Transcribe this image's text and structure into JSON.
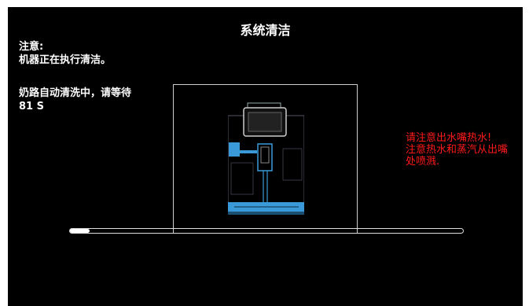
{
  "screen": {
    "title": "系统清洁",
    "note_heading": "注意:",
    "note_body": "机器正在执行清洁。",
    "wait_message": "奶路自动清洗中，请等待 81 S",
    "warning_line1": "请注意出水嘴热水!",
    "warning_line2": "注意热水和蒸汽从出嘴处喷溅."
  },
  "progress": {
    "fraction": 0.05
  },
  "colors": {
    "background": "#000000",
    "text": "#ffffff",
    "warning": "#ff1a1a",
    "machine_highlight": "#3a9ad9"
  },
  "icons": {
    "machine": "coffee-machine-cleaning-illustration"
  }
}
